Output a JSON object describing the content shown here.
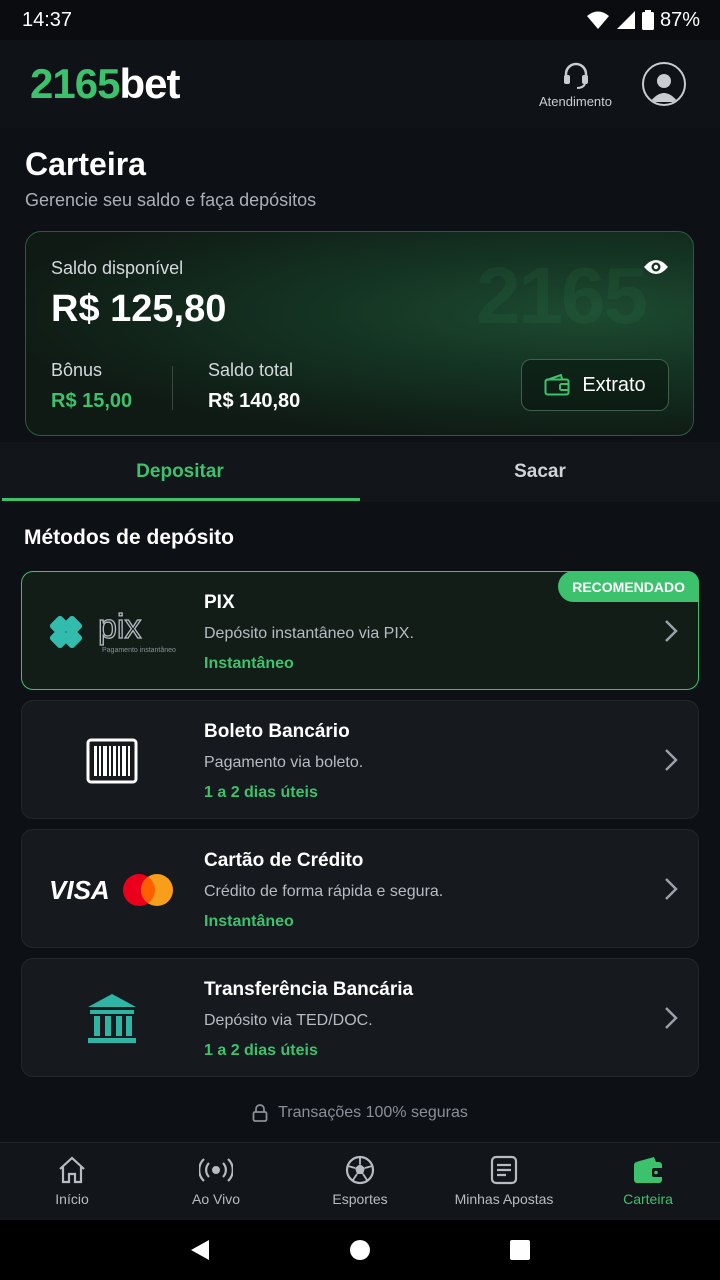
{
  "status_bar": {
    "time": "14:37",
    "battery": "87%"
  },
  "header": {
    "logo_num": "2165",
    "logo_bet": "bet",
    "support_label": "Atendimento"
  },
  "page": {
    "title": "Carteira",
    "subtitle": "Gerencie seu saldo e faça depósitos"
  },
  "balance": {
    "label": "Saldo disponível",
    "value": "R$ 125,80",
    "bonus_label": "Bônus",
    "bonus_value": "R$ 15,00",
    "total_label": "Saldo total",
    "total_value": "R$ 140,80",
    "extrato_label": "Extrato",
    "watermark": "2165"
  },
  "tabs": [
    {
      "label": "Depositar",
      "active": true
    },
    {
      "label": "Sacar",
      "active": false
    }
  ],
  "methods_title": "Métodos de depósito",
  "methods": [
    {
      "title": "PIX",
      "desc": "Depósito instantâneo via PIX.",
      "speed": "Instantâneo",
      "badge": "RECOMENDADO",
      "logo": "pix-logo",
      "logo_text": "pix",
      "logo_subtext": "Pagamento instantâneo"
    },
    {
      "title": "Boleto Bancário",
      "desc": "Pagamento via boleto.",
      "speed": "1 a 2 dias úteis",
      "logo": "barcode-icon"
    },
    {
      "title": "Cartão de Crédito",
      "desc": "Crédito de forma rápida e segura.",
      "speed": "Instantâneo",
      "logo": "visa-mastercard-logo",
      "logo_text": "VISA"
    },
    {
      "title": "Transferência Bancária",
      "desc": "Depósito via TED/DOC.",
      "speed": "1 a 2 dias úteis",
      "logo": "bank-icon"
    }
  ],
  "secure_text": "Transações 100% seguras",
  "bottom_nav": [
    {
      "label": "Início",
      "icon": "home-icon"
    },
    {
      "label": "Ao Vivo",
      "icon": "live-icon"
    },
    {
      "label": "Esportes",
      "icon": "soccer-ball-icon"
    },
    {
      "label": "Minhas Apostas",
      "icon": "bets-list-icon"
    },
    {
      "label": "Carteira",
      "icon": "wallet-icon",
      "active": true
    }
  ],
  "colors": {
    "accent": "#3cc26d",
    "background": "#0d1014",
    "card": "#16191e"
  }
}
